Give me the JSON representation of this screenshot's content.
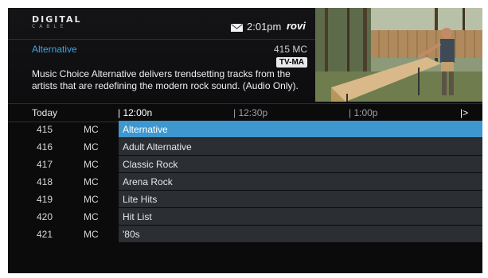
{
  "header": {
    "logo_top": "DIGITAL",
    "logo_bottom": "CABLE",
    "time": "2:01pm",
    "brand": "rovi"
  },
  "program": {
    "title": "Alternative",
    "channel_info": "415 MC",
    "rating": "TV-MA",
    "description": "Music Choice Alternative delivers trendsetting tracks from the artists that are redefining the modern rock sound. (Audio Only)."
  },
  "grid": {
    "date_label": "Today",
    "time_slots": [
      "12:00n",
      "12:30p",
      "1:00p"
    ],
    "next_icon": "chevron-right-icon",
    "rows": [
      {
        "number": "415",
        "code": "MC",
        "program": "Alternative",
        "selected": true
      },
      {
        "number": "416",
        "code": "MC",
        "program": "Adult Alternative",
        "selected": false
      },
      {
        "number": "417",
        "code": "MC",
        "program": "Classic Rock",
        "selected": false
      },
      {
        "number": "418",
        "code": "MC",
        "program": "Arena Rock",
        "selected": false
      },
      {
        "number": "419",
        "code": "MC",
        "program": "Lite Hits",
        "selected": false
      },
      {
        "number": "420",
        "code": "MC",
        "program": "Hit List",
        "selected": false
      },
      {
        "number": "421",
        "code": "MC",
        "program": "'80s",
        "selected": false
      }
    ]
  },
  "colors": {
    "accent": "#3aa6e6",
    "selected_row": "#3f97cf",
    "row_bg": "#2b2e33",
    "background": "#0b0b0c"
  }
}
